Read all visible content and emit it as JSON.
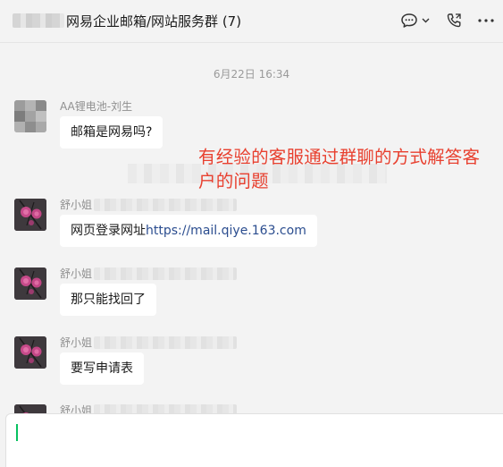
{
  "header": {
    "title": "网易企业邮箱/网站服务群 (7)",
    "icons": [
      "chat-bubble-icon",
      "chevron-down-icon",
      "phone-call-icon",
      "more-icon"
    ]
  },
  "timestamp": "6月22日 16:34",
  "annotation": "有经验的客服通过群聊的方式解答客户的问题",
  "messages": [
    {
      "sender": "AA锂电池-刘生",
      "text": "邮箱是网易吗?"
    },
    {
      "sender": "舒小姐",
      "text_prefix": "网页登录网址",
      "link": "https://mail.qiye.163.com"
    },
    {
      "sender": "舒小姐",
      "text": "那只能找回了"
    },
    {
      "sender": "舒小姐",
      "text": "要写申请表"
    },
    {
      "sender": "舒小姐"
    }
  ],
  "colors": {
    "background": "#f3f3f3",
    "bubble": "#ffffff",
    "annotation": "#e8402f",
    "link": "#2b4d8f",
    "caret": "#07c160"
  }
}
